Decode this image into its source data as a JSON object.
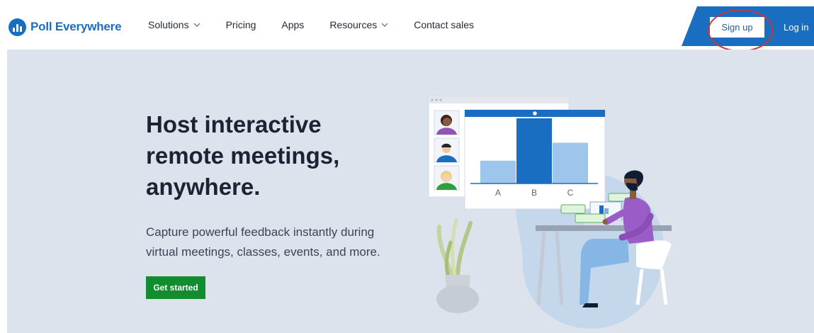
{
  "nav": {
    "brand": "Poll Everywhere",
    "links": [
      {
        "label": "Solutions",
        "dropdown": true
      },
      {
        "label": "Pricing",
        "dropdown": false
      },
      {
        "label": "Apps",
        "dropdown": false
      },
      {
        "label": "Resources",
        "dropdown": true
      },
      {
        "label": "Contact sales",
        "dropdown": false
      }
    ],
    "signup_label": "Sign up",
    "login_label": "Log in"
  },
  "hero": {
    "title": "Host interactive remote meetings, anywhere.",
    "subtitle": "Capture powerful feedback instantly during virtual meetings, classes, events, and more.",
    "cta_label": "Get started"
  },
  "illustration": {
    "poll_bars": [
      {
        "label": "A",
        "value": 0.28
      },
      {
        "label": "B",
        "value": 0.8
      },
      {
        "label": "C",
        "value": 0.5
      }
    ]
  },
  "colors": {
    "brand_blue": "#1a6ec1",
    "hero_bg": "#dde3ed",
    "cta_green": "#118c2e",
    "highlight_red": "#c33a3a"
  }
}
